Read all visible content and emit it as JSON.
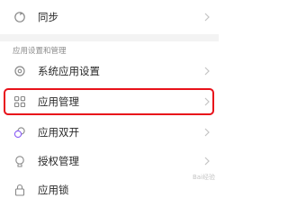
{
  "top_item": {
    "label": "同步",
    "icon": "sync-icon"
  },
  "section": {
    "title": "应用设置和管理"
  },
  "items": [
    {
      "label": "系统应用设置",
      "icon": "gear-icon"
    },
    {
      "label": "应用管理",
      "icon": "grid-icon"
    },
    {
      "label": "应用双开",
      "icon": "dual-app-icon"
    },
    {
      "label": "授权管理",
      "icon": "shield-icon"
    },
    {
      "label": "应用锁",
      "icon": "lock-icon"
    }
  ],
  "watermark": "Bai经验",
  "colors": {
    "highlight": "#e8121b",
    "section_bg": "#f3f3f3",
    "icon": "#888888"
  }
}
